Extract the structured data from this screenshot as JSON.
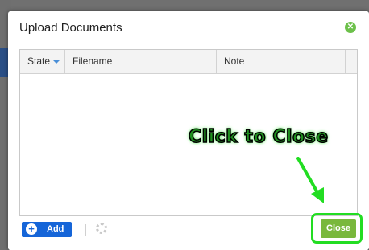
{
  "dialog": {
    "title": "Upload Documents",
    "close_icon": "close-circle-icon"
  },
  "grid": {
    "columns": [
      "State",
      "Filename",
      "Note"
    ],
    "sorted_column": "State",
    "rows": []
  },
  "footer": {
    "add_label": "Add",
    "close_label": "Close"
  },
  "annotation": {
    "text": "Click to Close",
    "color": "#22dd22"
  },
  "colors": {
    "accent_blue": "#1565d8",
    "close_green": "#79b83c"
  }
}
